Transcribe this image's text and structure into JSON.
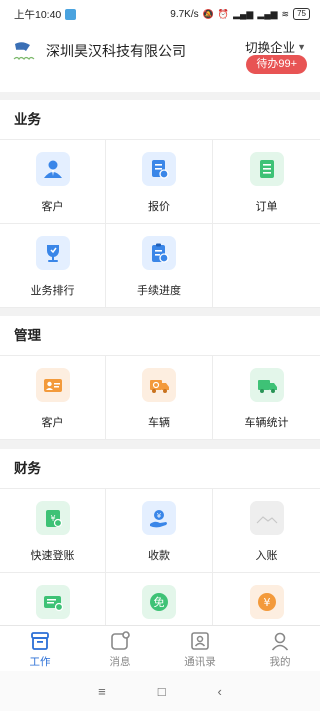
{
  "status_bar": {
    "time": "上午10:40",
    "speed": "9.7K/s",
    "battery": "75"
  },
  "header": {
    "company": "深圳昊汉科技有限公司",
    "switch_label": "切换企业",
    "todo_badge": "待办99+"
  },
  "sections": [
    {
      "title": "业务",
      "items": [
        {
          "label": "客户",
          "icon": "customer-person-icon"
        },
        {
          "label": "报价",
          "icon": "quote-document-icon"
        },
        {
          "label": "订单",
          "icon": "order-list-icon"
        },
        {
          "label": "业务排行",
          "icon": "trophy-ranking-icon"
        },
        {
          "label": "手续进度",
          "icon": "clipboard-progress-icon"
        }
      ]
    },
    {
      "title": "管理",
      "items": [
        {
          "label": "客户",
          "icon": "customer-card-icon"
        },
        {
          "label": "车辆",
          "icon": "truck-icon"
        },
        {
          "label": "车辆统计",
          "icon": "truck-stats-icon"
        }
      ]
    },
    {
      "title": "财务",
      "items": [
        {
          "label": "快速登账",
          "icon": "quick-ledger-icon"
        },
        {
          "label": "收款",
          "icon": "receive-payment-icon"
        },
        {
          "label": "入账",
          "icon": "image-placeholder-icon"
        },
        {
          "label": "",
          "icon": "money-card-icon"
        },
        {
          "label": "",
          "icon": "free-icon",
          "text": "免"
        },
        {
          "label": "",
          "icon": "yuan-coin-icon",
          "text": "¥"
        }
      ]
    }
  ],
  "tabs": [
    {
      "label": "工作",
      "icon": "work-box-icon",
      "active": true
    },
    {
      "label": "消息",
      "icon": "message-icon",
      "active": false
    },
    {
      "label": "通讯录",
      "icon": "contacts-icon",
      "active": false
    },
    {
      "label": "我的",
      "icon": "profile-icon",
      "active": false
    }
  ],
  "nav": {
    "menu": "≡",
    "home": "□",
    "back": "‹"
  },
  "colors": {
    "accent_blue": "#2b6fd6",
    "badge_red": "#e85454",
    "icon_green": "#3ec276",
    "icon_orange": "#f39a3b"
  }
}
